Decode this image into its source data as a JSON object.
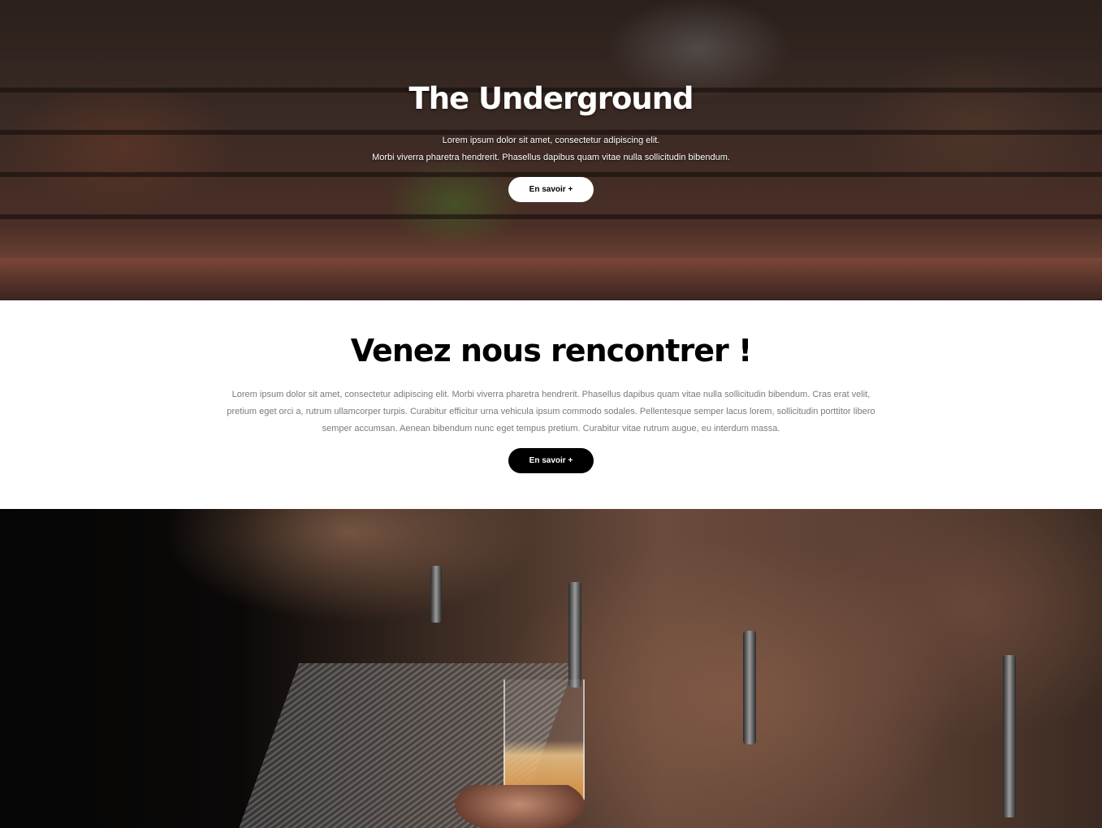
{
  "hero": {
    "title": "The Underground",
    "line1": "Lorem ipsum dolor sit amet, consectetur adipiscing elit.",
    "line2": "Morbi viverra pharetra hendrerit. Phasellus dapibus quam vitae nulla sollicitudin bibendum.",
    "button_label": "En savoir +"
  },
  "meet": {
    "title": "Venez nous rencontrer !",
    "text": "Lorem ipsum dolor sit amet, consectetur adipiscing elit. Morbi viverra pharetra hendrerit. Phasellus dapibus quam vitae nulla sollicitudin bibendum. Cras erat velit, pretium eget orci a, rutrum ullamcorper turpis. Curabitur efficitur urna vehicula ipsum commodo sodales. Pellentesque semper lacus lorem, sollicitudin porttitor libero semper accumsan. Aenean bibendum nunc eget tempus pretium. Curabitur vitae rutrum augue, eu interdum massa.",
    "button_label": "En savoir +"
  }
}
